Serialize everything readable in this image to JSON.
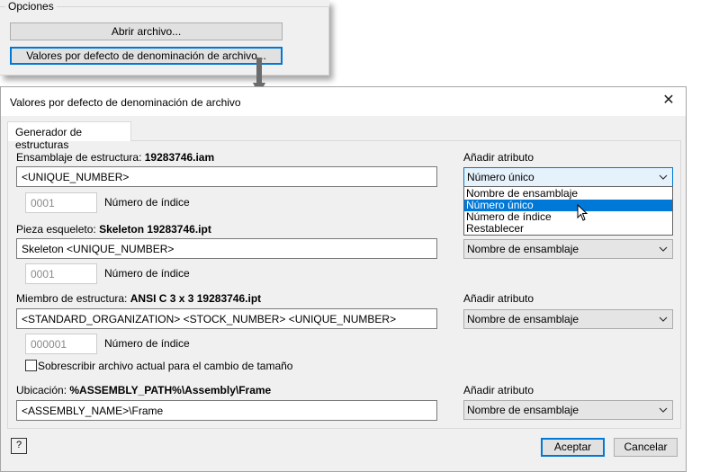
{
  "options": {
    "group_title": "Opciones",
    "open_file_label": "Abrir archivo...",
    "naming_defaults_label": "Valores por defecto de denominación de archivo..."
  },
  "dialog": {
    "title": "Valores por defecto de denominación de archivo",
    "tab_label": "Generador de estructuras",
    "add_attribute_label": "Añadir atributo",
    "index_number_label": "Número de índice",
    "assembly": {
      "label": "Ensamblaje de estructura:",
      "filename": "19283746.iam",
      "value": "<UNIQUE_NUMBER>",
      "index": "0001",
      "attribute_combo": "Número único"
    },
    "skeleton": {
      "label": "Pieza esqueleto:",
      "filename": "Skeleton 19283746.ipt",
      "value": "Skeleton <UNIQUE_NUMBER>",
      "index": "0001",
      "attribute_combo": "Nombre de ensamblaje"
    },
    "member": {
      "label": "Miembro de estructura:",
      "filename": "ANSI C 3 x 3 19283746.ipt",
      "value": "<STANDARD_ORGANIZATION> <STOCK_NUMBER> <UNIQUE_NUMBER>",
      "index": "000001",
      "attribute_combo": "Nombre de ensamblaje",
      "overwrite_label": "Sobrescribir archivo actual para el cambio de tamaño"
    },
    "location": {
      "label": "Ubicación:",
      "path": "%ASSEMBLY_PATH%\\Assembly\\Frame",
      "value": "<ASSEMBLY_NAME>\\Frame",
      "attribute_combo": "Nombre de ensamblaje"
    },
    "dropdown_options": [
      "Nombre de ensamblaje",
      "Número único",
      "Número de índice",
      "Restablecer"
    ],
    "dropdown_selected": "Número único",
    "ok_label": "Aceptar",
    "cancel_label": "Cancelar"
  },
  "icons": [
    "close-icon",
    "chevron-down-icon",
    "help-icon",
    "mouse-cursor-icon",
    "arrow-down-icon"
  ]
}
